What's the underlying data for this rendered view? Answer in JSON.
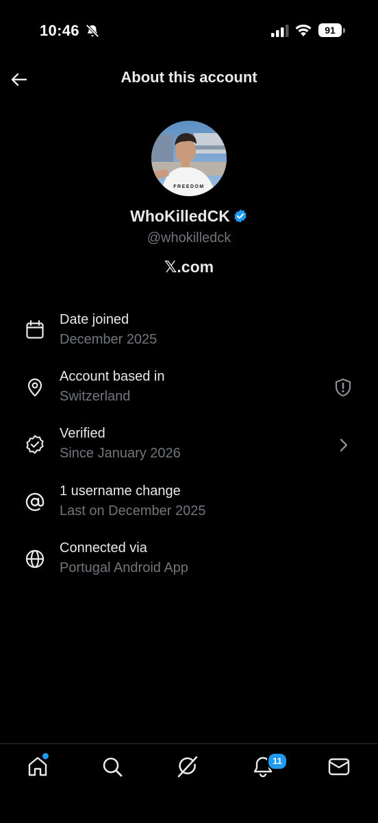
{
  "status_bar": {
    "time": "10:46",
    "battery": "91"
  },
  "header": {
    "title": "About this account"
  },
  "profile": {
    "display_name": "WhoKilledCK",
    "handle": "@whokilledck",
    "site": "𝕏.com",
    "shirt_text": "FREEDOM"
  },
  "details": [
    {
      "label": "Date joined",
      "value": "December 2025",
      "icon": "calendar-icon"
    },
    {
      "label": "Account based in",
      "value": "Switzerland",
      "icon": "location-pin-icon",
      "right_icon": "shield-alert-icon"
    },
    {
      "label": "Verified",
      "value": "Since January 2026",
      "icon": "verified-badge-icon",
      "right_icon": "chevron-right-icon"
    },
    {
      "label": "1 username change",
      "value": "Last on December 2025",
      "icon": "at-sign-icon"
    },
    {
      "label": "Connected via",
      "value": "Portugal Android App",
      "icon": "globe-icon"
    }
  ],
  "bottom_nav": {
    "items": [
      "home-icon",
      "search-icon",
      "grok-icon",
      "notifications-icon",
      "messages-icon"
    ],
    "notification_count": "11"
  },
  "colors": {
    "background": "#000000",
    "text": "#e7e9ea",
    "secondary": "#71767b",
    "accent": "#1d9bf0"
  }
}
